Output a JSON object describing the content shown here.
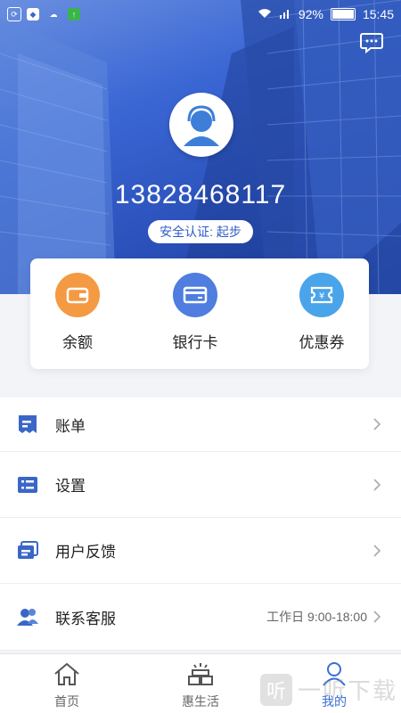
{
  "status_bar": {
    "battery": "92%",
    "time": "15:45"
  },
  "user": {
    "phone": "13828468117",
    "auth_badge": "安全认证: 起步"
  },
  "quick_actions": [
    {
      "label": "余额",
      "icon": "wallet-icon",
      "color": "#f39a42"
    },
    {
      "label": "银行卡",
      "icon": "bank-card-icon",
      "color": "#4f7de0"
    },
    {
      "label": "优惠券",
      "icon": "coupon-icon",
      "color": "#4aa4ea"
    }
  ],
  "menu": [
    {
      "label": "账单",
      "icon": "bill-icon"
    },
    {
      "label": "设置",
      "icon": "settings-list-icon"
    },
    {
      "label": "用户反馈",
      "icon": "feedback-icon"
    },
    {
      "label": "联系客服",
      "icon": "customer-service-icon",
      "note": "工作日 9:00-18:00"
    }
  ],
  "tabs": [
    {
      "label": "首页",
      "icon": "home-icon"
    },
    {
      "label": "惠生活",
      "icon": "life-icon"
    },
    {
      "label": "我的",
      "icon": "profile-icon",
      "active": true
    }
  ],
  "colors": {
    "accent": "#3a6fd6",
    "hero": "#2a4fb8"
  },
  "watermark": {
    "text": "一听下载",
    "logo": "听"
  }
}
